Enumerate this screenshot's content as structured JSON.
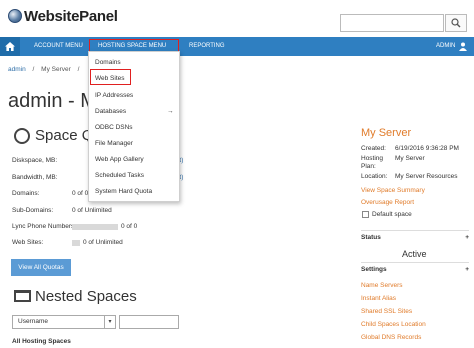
{
  "header": {
    "logo_text": "WebsitePanel",
    "search": {
      "value": "",
      "placeholder": ""
    }
  },
  "nav": {
    "account_menu": "ACCOUNT MENU",
    "hosting_space_menu": "HOSTING SPACE MENU",
    "reporting": "REPORTING",
    "user": "ADMIN"
  },
  "breadcrumb": {
    "items": [
      "admin",
      "My Server"
    ]
  },
  "page_title": "admin - My",
  "space_quota": {
    "title": "Space Quo",
    "rows": [
      {
        "label": "Diskspace, MB:",
        "link": "port)"
      },
      {
        "label": "Bandwidth, MB:",
        "link": "port)"
      },
      {
        "label": "Domains:",
        "value": "0 of 0"
      },
      {
        "label": "Sub-Domains:",
        "value": "0 of Unlimited"
      },
      {
        "label": "Lync Phone Numbers:",
        "value": "0 of 0"
      },
      {
        "label": "Web Sites:",
        "value": "0 of Unlimited"
      }
    ],
    "view_all_button": "View All Quotas"
  },
  "nested_spaces": {
    "title": "Nested Spaces",
    "filter_select": "Username",
    "filter_value": "",
    "list_header": "All Hosting Spaces"
  },
  "dropdown": {
    "items": [
      {
        "label": "Domains"
      },
      {
        "label": "Web Sites"
      },
      {
        "label": "IP Addresses"
      },
      {
        "label": "Databases",
        "arrow": "→"
      },
      {
        "label": "ODBC DSNs"
      },
      {
        "label": "File Manager"
      },
      {
        "label": "Web App Gallery"
      },
      {
        "label": "Scheduled Tasks"
      },
      {
        "label": "System Hard Quota"
      }
    ]
  },
  "server_panel": {
    "title": "My Server",
    "created_label": "Created:",
    "created_value": "6/19/2016 9:36:28 PM",
    "plan_label_1": "Hosting",
    "plan_label_2": "Plan:",
    "plan_value": "My Server",
    "location_label": "Location:",
    "location_value": "My Server Resources",
    "links": [
      "View Space Summary",
      "Overusage Report"
    ],
    "default_space": "Default space",
    "status_section": "Status",
    "status_value": "Active",
    "settings_section": "Settings",
    "settings_links": [
      "Name Servers",
      "Instant Alias",
      "Shared SSL Sites",
      "Child Spaces Location",
      "Global DNS Records"
    ],
    "plus": "+"
  },
  "colors": {
    "nav": "#2f7fc1",
    "accent": "#e07b2a",
    "button": "#5b9bd5",
    "highlight": "#e02020"
  }
}
